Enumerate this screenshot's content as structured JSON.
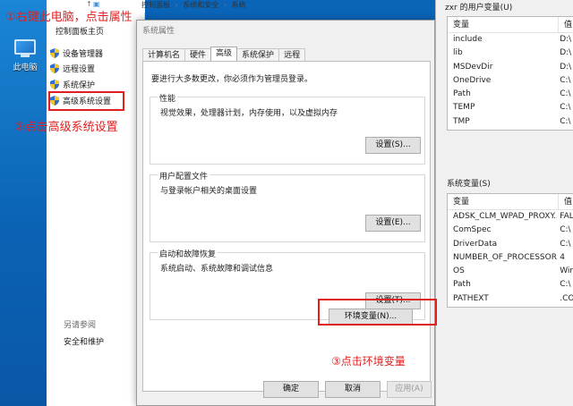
{
  "desktop": {
    "this_pc_label": "此电脑"
  },
  "system_window": {
    "breadcrumb": [
      "控制面板",
      "系统和安全",
      "系统"
    ],
    "home_link": "控制面板主页",
    "links": [
      "设备管理器",
      "远程设置",
      "系统保护",
      "高级系统设置"
    ],
    "see_also": "另请参阅",
    "security_link": "安全和维护"
  },
  "dialog": {
    "title": "系统属性",
    "tabs": [
      "计算机名",
      "硬件",
      "高级",
      "系统保护",
      "远程"
    ],
    "active_tab": "高级",
    "admin_note": "要进行大多数更改，你必须作为管理员登录。",
    "performance": {
      "title": "性能",
      "desc": "视觉效果，处理器计划，内存使用，以及虚拟内存",
      "button": "设置(S)..."
    },
    "user_profiles": {
      "title": "用户配置文件",
      "desc": "与登录帐户相关的桌面设置",
      "button": "设置(E)..."
    },
    "startup": {
      "title": "启动和故障恢复",
      "desc": "系统启动、系统故障和调试信息",
      "button": "设置(T)..."
    },
    "env_button": "环境变量(N)...",
    "ok": "确定",
    "cancel": "取消",
    "apply": "应用(A)"
  },
  "env_window": {
    "user_vars_title": "zxr 的用户变量(U)",
    "system_vars_title": "系统变量(S)",
    "col_var": "变量",
    "col_val": "值",
    "user_vars": [
      [
        "include",
        "D:\\"
      ],
      [
        "lib",
        "D:\\"
      ],
      [
        "MSDevDir",
        "D:\\"
      ],
      [
        "OneDrive",
        "C:\\"
      ],
      [
        "Path",
        "C:\\"
      ],
      [
        "TEMP",
        "C:\\"
      ],
      [
        "TMP",
        "C:\\"
      ]
    ],
    "system_vars": [
      [
        "ADSK_CLM_WPAD_PROXY...",
        "FAL"
      ],
      [
        "ComSpec",
        "C:\\"
      ],
      [
        "DriverData",
        "C:\\"
      ],
      [
        "NUMBER_OF_PROCESSORS",
        "4"
      ],
      [
        "OS",
        "Wir"
      ],
      [
        "Path",
        "C:\\"
      ],
      [
        "PATHEXT",
        ".CO"
      ]
    ]
  },
  "annotations": {
    "step1": "①右键此电脑，点击属性",
    "step2": "②点击高级系统设置",
    "step3": "③点击环境变量"
  },
  "colors": {
    "annotation": "#e02020",
    "desktop": "#0b63b5"
  }
}
